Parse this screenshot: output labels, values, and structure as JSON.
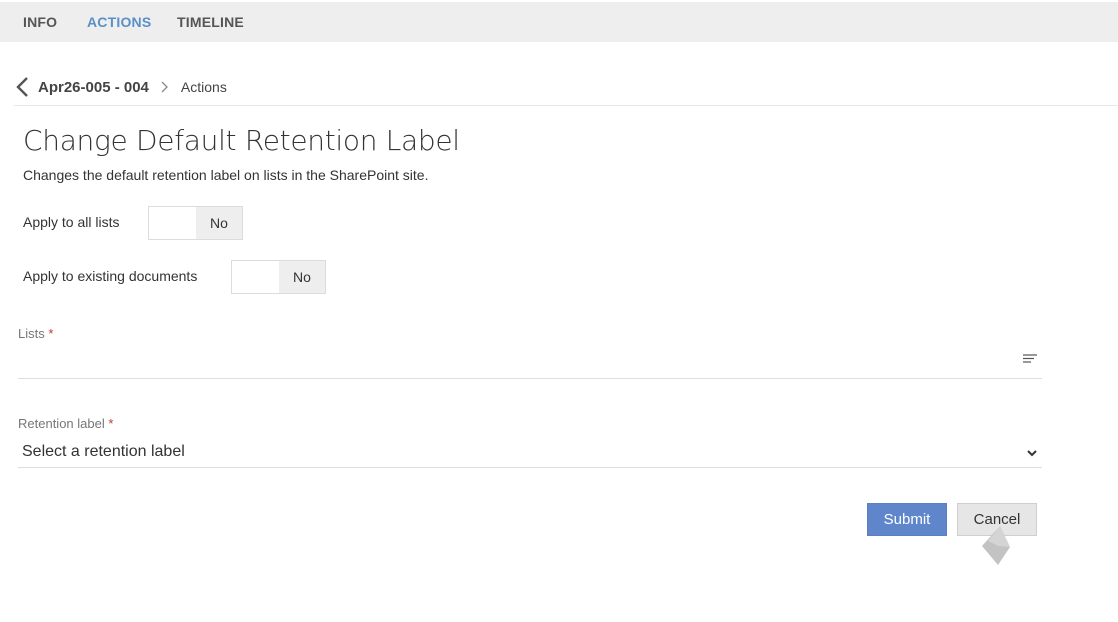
{
  "tabs": [
    {
      "label": "INFO",
      "active": false
    },
    {
      "label": "ACTIONS",
      "active": true
    },
    {
      "label": "TIMELINE",
      "active": false
    }
  ],
  "breadcrumb": {
    "parent": "Apr26-005 - 004",
    "current": "Actions"
  },
  "page": {
    "title": "Change Default Retention Label",
    "description": "Changes the default retention label on lists in the SharePoint site."
  },
  "form": {
    "apply_all_lists": {
      "label": "Apply to all lists",
      "state": "No"
    },
    "apply_existing_docs": {
      "label": "Apply to existing documents",
      "state": "No"
    },
    "lists": {
      "label": "Lists",
      "required_mark": "*",
      "value": ""
    },
    "retention_label": {
      "label": "Retention label",
      "required_mark": "*",
      "value": "Select a retention label"
    }
  },
  "buttons": {
    "submit": "Submit",
    "cancel": "Cancel"
  },
  "icons": {
    "back": "chevron-left-icon",
    "separator": "chevron-right-icon",
    "lists_picker": "list-lines-icon",
    "dropdown": "chevron-down-icon"
  },
  "colors": {
    "accent": "#5b8fc7",
    "submit_bg": "#5f86cb",
    "tabbar_bg": "#eeeeee",
    "required": "#c0392b"
  }
}
